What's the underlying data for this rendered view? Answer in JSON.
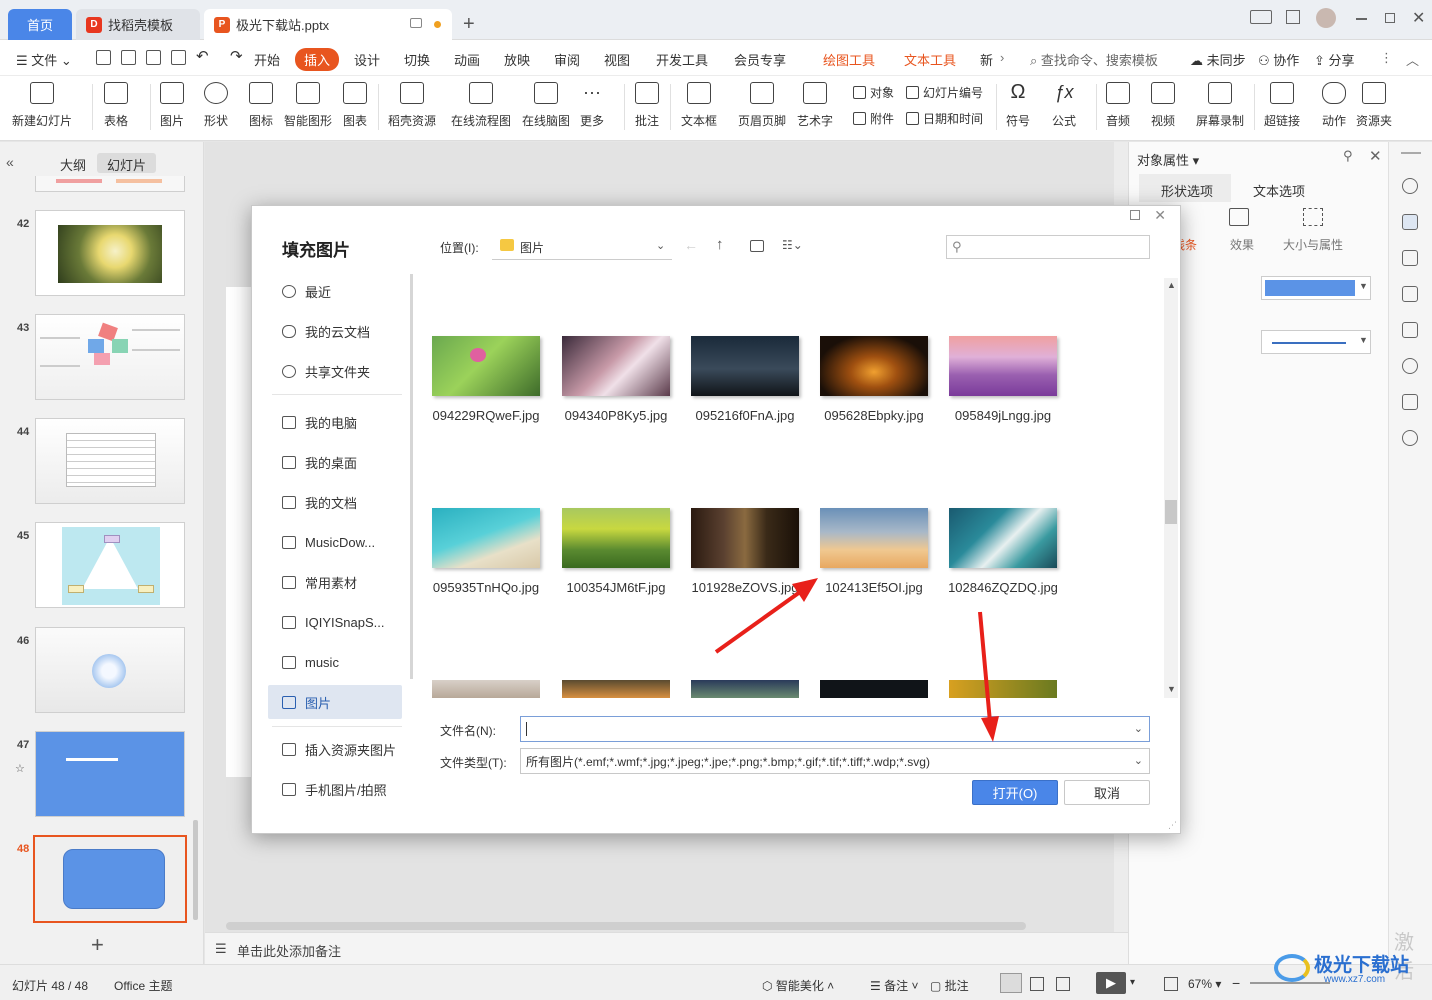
{
  "titlebar": {
    "tabs": [
      {
        "label": "首页"
      },
      {
        "label": "找稻壳模板"
      },
      {
        "label": "极光下载站.pptx"
      }
    ],
    "new_tab": "+"
  },
  "menu": {
    "file": "文件",
    "items": [
      "开始",
      "插入",
      "设计",
      "切换",
      "动画",
      "放映",
      "审阅",
      "视图",
      "开发工具",
      "会员专享",
      "绘图工具",
      "文本工具",
      "新"
    ],
    "search": "查找命令、搜索模板",
    "sync": "未同步",
    "collab": "协作",
    "share": "分享"
  },
  "ribbon": {
    "new_slide": "新建幻灯片",
    "table": "表格",
    "picture": "图片",
    "shape": "形状",
    "icon": "图标",
    "smart": "智能图形",
    "chart": "图表",
    "docer": "稻壳资源",
    "flow": "在线流程图",
    "mind": "在线脑图",
    "more": "更多",
    "comment": "批注",
    "textbox": "文本框",
    "headerfooter": "页眉页脚",
    "wordart": "艺术字",
    "object": "对象",
    "slidenum": "幻灯片编号",
    "attach": "附件",
    "datetime": "日期和时间",
    "symbol": "符号",
    "formula": "公式",
    "audio": "音频",
    "video": "视频",
    "screenrec": "屏幕录制",
    "hyperlink": "超链接",
    "action": "动作",
    "resfolder": "资源夹"
  },
  "leftpanel": {
    "tab_outline": "大纲",
    "tab_slides": "幻灯片",
    "slides": [
      "42",
      "43",
      "44",
      "45",
      "46",
      "47",
      "48"
    ],
    "add": "+"
  },
  "notes": "单击此处添加备注",
  "rightpanel": {
    "title": "对象属性",
    "tab_shape": "形状选项",
    "tab_text": "文本选项",
    "sub_line": "线条",
    "sub_effect": "效果",
    "sub_size": "大小与属性",
    "fill_color": "#4a86e8"
  },
  "statusbar": {
    "slide": "幻灯片 48 / 48",
    "theme": "Office 主题",
    "beautify": "智能美化",
    "notes": "备注",
    "comment": "批注",
    "zoom": "67%"
  },
  "dialog": {
    "title": "填充图片",
    "location_label": "位置(I):",
    "location_value": "图片",
    "nav": [
      "最近",
      "我的云文档",
      "共享文件夹",
      "我的电脑",
      "我的桌面",
      "我的文档",
      "MusicDow...",
      "常用素材",
      "IQIYISnapS...",
      "music",
      "图片",
      "插入资源夹图片",
      "手机图片/拍照"
    ],
    "files": [
      "094229RQweF.jpg",
      "094340P8Ky5.jpg",
      "095216f0FnA.jpg",
      "095628Ebpky.jpg",
      "095849jLngg.jpg",
      "095935TnHQo.jpg",
      "100354JM6tF.jpg",
      "101928eZOVS.jpg",
      "102413Ef5OI.jpg",
      "102846ZQZDQ.jpg"
    ],
    "filename_label": "文件名(N):",
    "filename_value": "",
    "filetype_label": "文件类型(T):",
    "filetype_value": "所有图片(*.emf;*.wmf;*.jpg;*.jpeg;*.jpe;*.png;*.bmp;*.gif;*.tif;*.tiff;*.wdp;*.svg)",
    "open": "打开(O)",
    "cancel": "取消"
  },
  "watermark": {
    "site": "极光下载站",
    "url": "www.xz7.com",
    "activate": "激活"
  }
}
